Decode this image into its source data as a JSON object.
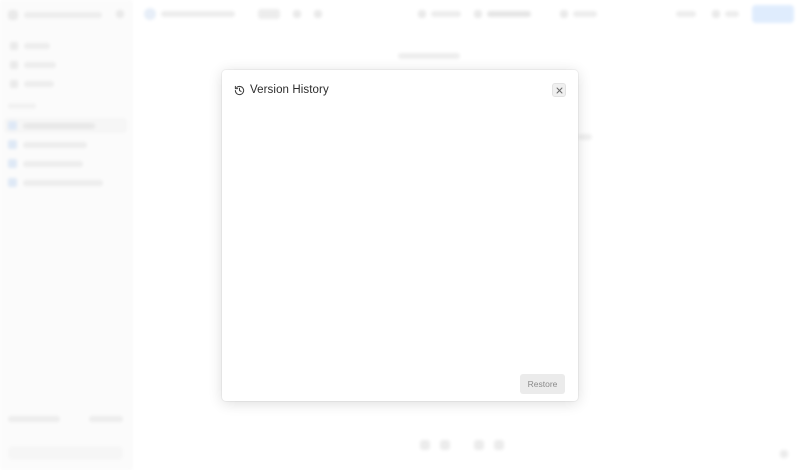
{
  "modal": {
    "title": "Version History",
    "icon": "history-icon",
    "close_icon": "close-icon",
    "restore_label": "Restore"
  },
  "colors": {
    "overlay": "rgba(255,255,255,0.55)",
    "modal_bg": "#ffffff",
    "title_text": "#2b2b2b",
    "restore_bg": "#ebebeb",
    "restore_text": "#8a8a8a",
    "share_button_bg": "#b9d6fb"
  }
}
